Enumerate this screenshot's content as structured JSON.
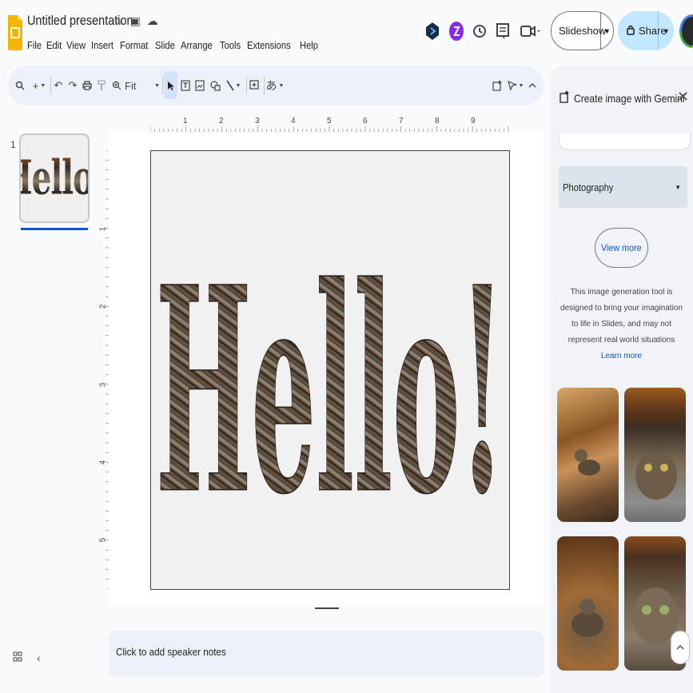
{
  "header": {
    "title": "Untitled presentation",
    "menu": [
      "File",
      "Edit",
      "View",
      "Insert",
      "Format",
      "Slide",
      "Arrange",
      "Tools",
      "Extensions",
      "Help"
    ],
    "slideshow_label": "Slideshow",
    "share_label": "Share"
  },
  "toolbar": {
    "zoom_label": "Fit",
    "input_tools_label": "あ"
  },
  "rulers": {
    "horizontal": [
      "1",
      "2",
      "3",
      "4",
      "5",
      "6",
      "7",
      "8",
      "9"
    ],
    "vertical": [
      "1",
      "2",
      "3",
      "4",
      "5"
    ]
  },
  "filmstrip": {
    "slide_number": "1",
    "thumb_text": "Hello!"
  },
  "slide": {
    "text": "Hello!"
  },
  "notes": {
    "placeholder": "Click to add speaker notes"
  },
  "panel": {
    "title": "Create image with Gemini",
    "style_value": "Photography",
    "view_more_label": "View more",
    "disclaimer": "This image generation tool is designed to bring your imagination to life in Slides, and may not represent real world situations",
    "learn_more_label": "Learn more"
  },
  "colors": {
    "accent": "#0b57d0",
    "share_bg": "#c2e7ff",
    "toolbar_bg": "#edf2fa",
    "panel_bg": "#f0f4f9",
    "slides_yellow": "#f4b400"
  }
}
